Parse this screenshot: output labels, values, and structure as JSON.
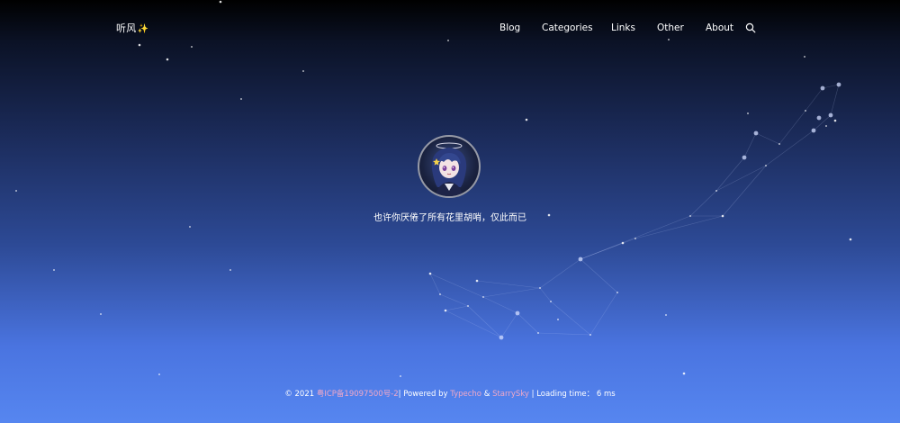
{
  "header": {
    "site_title": "听风",
    "site_title_emoji": "✨"
  },
  "nav": {
    "items": [
      {
        "label": "Blog"
      },
      {
        "label": "Categories"
      },
      {
        "label": "Links"
      },
      {
        "label": "Other"
      },
      {
        "label": "About"
      }
    ],
    "search_icon": "search-icon"
  },
  "profile": {
    "avatar_icon": "anime-avatar",
    "tagline": "也许你厌倦了所有花里胡哨，仅此而已"
  },
  "footer": {
    "copyright": "© 2021",
    "icp_link": "粤ICP备19097500号-2",
    "powered_by": "| Powered by",
    "typecho_link": "Typecho",
    "amp": "&",
    "theme_link": "StarrySky",
    "loading": "| Loading time：",
    "loading_value": "6 ms"
  },
  "colors": {
    "link": "#f0a8c8",
    "sky_top": "#000000",
    "sky_bottom": "#5686f0",
    "sparkle": "#ffd84a"
  }
}
